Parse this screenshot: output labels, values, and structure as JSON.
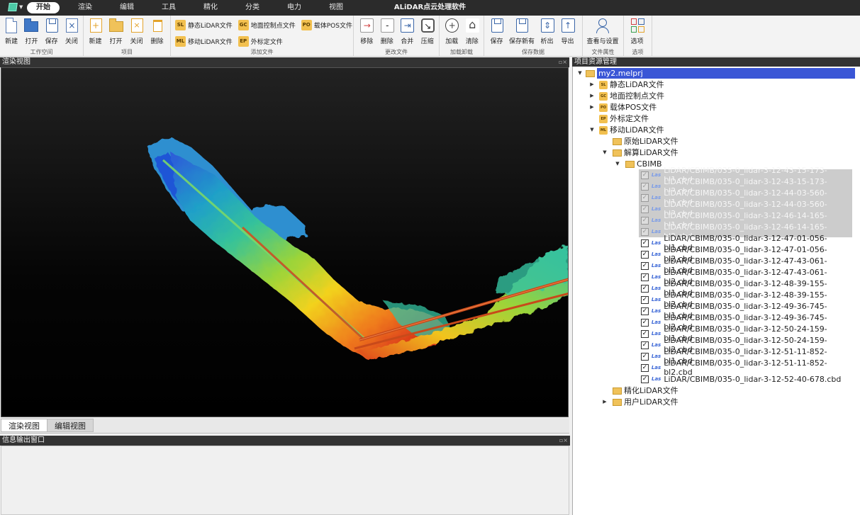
{
  "titlebar": {
    "app_title": "ALiDAR点云处理软件",
    "menu": [
      "开始",
      "渲染",
      "编辑",
      "工具",
      "精化",
      "分类",
      "电力",
      "视图"
    ],
    "active_menu_index": 0
  },
  "ribbon": {
    "workspace": {
      "label": "工作空间",
      "new": "新建",
      "open": "打开",
      "save": "保存",
      "close": "关闭"
    },
    "project": {
      "label": "项目",
      "new": "新建",
      "open": "打开",
      "close": "关闭",
      "delete": "删除"
    },
    "add_files": {
      "label": "添加文件",
      "static_lidar": {
        "tag": "SL",
        "text": "静态LiDAR文件"
      },
      "mobile_lidar": {
        "tag": "ML",
        "text": "移动LiDAR文件"
      },
      "ground_control": {
        "tag": "GC",
        "text": "地面控制点文件"
      },
      "external_calib": {
        "tag": "EP",
        "text": "外标定文件"
      },
      "carrier_pos": {
        "tag": "PO",
        "text": "载体POS文件"
      }
    },
    "change_files": {
      "label": "更改文件",
      "remove": "移除",
      "delete": "删除",
      "merge": "合并",
      "compress": "压缩"
    },
    "load_unload": {
      "label": "加载卸载",
      "load": "加载",
      "clear": "清除"
    },
    "save_data": {
      "label": "保存数据",
      "save": "保存",
      "save_new": "保存新有",
      "export_a": "析出",
      "export_b": "导出"
    },
    "file_props": {
      "label": "文件属性",
      "view_settings": "查看与设置"
    },
    "options": {
      "label": "选项",
      "options": "选项"
    }
  },
  "panels": {
    "render_view_title": "渲染视图",
    "output_title": "信息输出窗口",
    "tree_title": "项目资源管理",
    "tabs": [
      "渲染视图",
      "编辑视图"
    ]
  },
  "tree": {
    "root": "my2.melprj",
    "static_lidar": "静态LiDAR文件",
    "ground_control": "地面控制点文件",
    "carrier_pos": "载体POS文件",
    "external_calib": "外标定文件",
    "mobile_lidar": "移动LiDAR文件",
    "raw_lidar": "原始LiDAR文件",
    "solved_lidar": "解算LiDAR文件",
    "cbimb": "CBIMB",
    "refined_lidar": "精化LiDAR文件",
    "user_lidar": "用户LiDAR文件",
    "file_type": "Las",
    "files": [
      {
        "name": "LiDAR/CBIMB/035-0_lidar-3-12-43-15-173-bl1.cbd",
        "dim": true
      },
      {
        "name": "LiDAR/CBIMB/035-0_lidar-3-12-43-15-173-bl2.cbd",
        "dim": true
      },
      {
        "name": "LiDAR/CBIMB/035-0_lidar-3-12-44-03-560-bl1.cbd",
        "dim": true
      },
      {
        "name": "LiDAR/CBIMB/035-0_lidar-3-12-44-03-560-bl2.cbd",
        "dim": true
      },
      {
        "name": "LiDAR/CBIMB/035-0_lidar-3-12-46-14-165-bl1.cbd",
        "dim": true
      },
      {
        "name": "LiDAR/CBIMB/035-0_lidar-3-12-46-14-165-bl2.cbd",
        "dim": true
      },
      {
        "name": "LiDAR/CBIMB/035-0_lidar-3-12-47-01-056-bl1.cbd",
        "dim": false
      },
      {
        "name": "LiDAR/CBIMB/035-0_lidar-3-12-47-01-056-bl2.cbd",
        "dim": false
      },
      {
        "name": "LiDAR/CBIMB/035-0_lidar-3-12-47-43-061-bl1.cbd",
        "dim": false
      },
      {
        "name": "LiDAR/CBIMB/035-0_lidar-3-12-47-43-061-bl2.cbd",
        "dim": false
      },
      {
        "name": "LiDAR/CBIMB/035-0_lidar-3-12-48-39-155-bl1.cbd",
        "dim": false
      },
      {
        "name": "LiDAR/CBIMB/035-0_lidar-3-12-48-39-155-bl2.cbd",
        "dim": false
      },
      {
        "name": "LiDAR/CBIMB/035-0_lidar-3-12-49-36-745-bl1.cbd",
        "dim": false
      },
      {
        "name": "LiDAR/CBIMB/035-0_lidar-3-12-49-36-745-bl2.cbd",
        "dim": false
      },
      {
        "name": "LiDAR/CBIMB/035-0_lidar-3-12-50-24-159-bl1.cbd",
        "dim": false
      },
      {
        "name": "LiDAR/CBIMB/035-0_lidar-3-12-50-24-159-bl2.cbd",
        "dim": false
      },
      {
        "name": "LiDAR/CBIMB/035-0_lidar-3-12-51-11-852-bl1.cbd",
        "dim": false
      },
      {
        "name": "LiDAR/CBIMB/035-0_lidar-3-12-51-11-852-bl2.cbd",
        "dim": false
      },
      {
        "name": "LiDAR/CBIMB/035-0_lidar-3-12-52-40-678.cbd",
        "dim": false
      }
    ]
  },
  "colors": {
    "selection": "#3a56d6",
    "accent_tag": "#f2c04f",
    "dark_header": "#333333"
  }
}
